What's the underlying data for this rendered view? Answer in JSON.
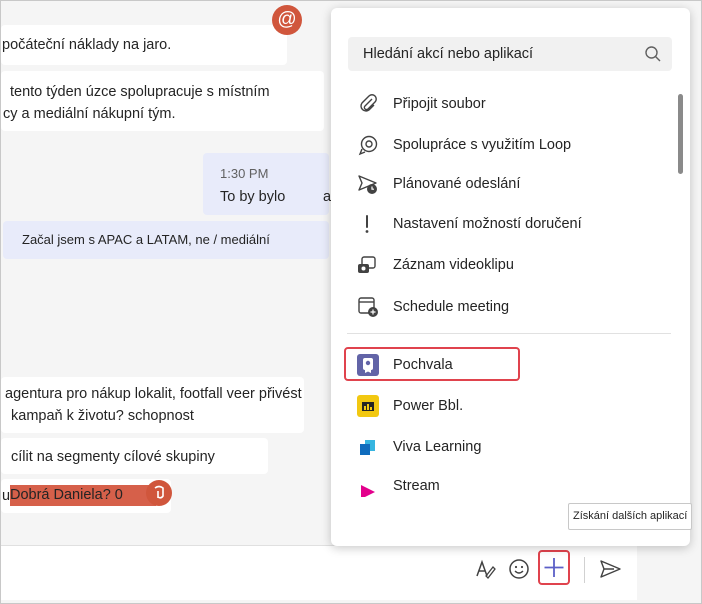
{
  "chat": {
    "msg1": "počáteční náklady na jaro.",
    "msg2_line1": "tento týden úzce spolupracuje s místním",
    "msg2_line2": "cy a mediální nákupní tým.",
    "msg3_time": "1:30 PM",
    "msg3_text": "To by bylo",
    "msg3_suffix": "a",
    "msg4": "Začal jsem s APAC a LATAM, ne / mediální",
    "msg5_line1": "agentura pro nákup lokalit, footfall veer přivést",
    "msg5_line2": "kampaň k životu? schopnost",
    "msg6": "cílit na segmenty cílové skupiny",
    "msg7_prefix": "u",
    "msg7_highlight": "Dobrá Daniela? 0",
    "mention_symbol": "@"
  },
  "panel": {
    "search_placeholder": "Hledání akcí nebo aplikací",
    "actions": [
      {
        "label": "Připojit soubor",
        "icon": "paperclip-icon"
      },
      {
        "label": "Spolupráce s využitím Loop",
        "icon": "loop-icon"
      },
      {
        "label": "Plánované odeslání",
        "icon": "scheduled-send-icon"
      },
      {
        "label": "Nastavení možností doručení",
        "icon": "exclamation-icon"
      },
      {
        "label": "Záznam videoklipu",
        "icon": "video-clip-icon"
      },
      {
        "label": "Schedule meeting",
        "icon": "calendar-add-icon"
      }
    ],
    "apps": [
      {
        "label": "Pochvala",
        "icon": "praise-app-icon",
        "color": "#6264a7"
      },
      {
        "label": "Power Bbl.",
        "icon": "power-bi-icon",
        "color": "#f2c811"
      },
      {
        "label": "Viva Learning",
        "icon": "viva-learning-icon",
        "color": "#0f6cbd"
      },
      {
        "label": "Stream",
        "icon": "stream-icon",
        "color": "#e3008c"
      }
    ],
    "get_more_apps": "Získání dalších aplikací"
  },
  "colors": {
    "accent": "#6264a7",
    "highlight_border": "#e0434d",
    "mention": "#d0563c"
  }
}
